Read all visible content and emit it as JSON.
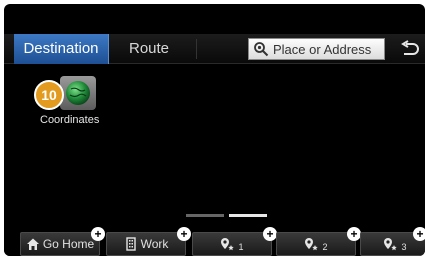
{
  "tabs": {
    "destination": "Destination",
    "route": "Route"
  },
  "search": {
    "placeholder": "Place or Address"
  },
  "menu": {
    "badge": "10",
    "coordinates_label": "Coordinates"
  },
  "quick_buttons": {
    "go_home": "Go Home",
    "work": "Work",
    "fav1": "1",
    "fav2": "2",
    "fav3": "3"
  },
  "colors": {
    "accent_tab": "#2f67b0",
    "badge": "#e39b1f",
    "background": "#000000"
  },
  "icons": {
    "search": "search-icon",
    "back": "back-icon",
    "globe": "globe-icon",
    "home": "home-icon",
    "work": "building-icon",
    "favorite": "pin-star-icon",
    "add": "plus-icon"
  },
  "pagination": {
    "current_page": 2,
    "total_pages": 2
  }
}
